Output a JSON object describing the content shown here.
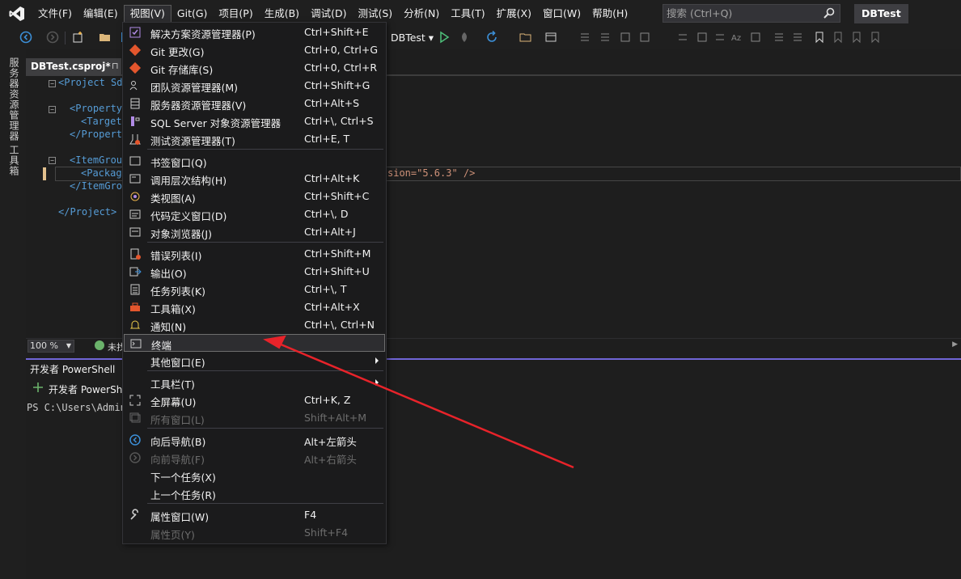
{
  "menubar": {
    "items": [
      "文件(F)",
      "编辑(E)",
      "视图(V)",
      "Git(G)",
      "项目(P)",
      "生成(B)",
      "调试(D)",
      "测试(S)",
      "分析(N)",
      "工具(T)",
      "扩展(X)",
      "窗口(W)",
      "帮助(H)"
    ],
    "search_placeholder": "搜索 (Ctrl+Q)",
    "solution_name": "DBTest"
  },
  "toolbar": {
    "config": "DBTest ▾"
  },
  "side_tabs": [
    "服务器资源管理器",
    "工具箱"
  ],
  "document": {
    "tab_label": "DBTest.csproj*",
    "tab_pin": "⊓",
    "lines": [
      "<Project Sd",
      "<Property",
      "<Target",
      "</Property",
      "<ItemGroup",
      "<Package",
      "</ItemGrou",
      "</Project>"
    ],
    "line6_tail": "sion=\"5.6.3\" />",
    "zoom": "100 %",
    "issues": "未找"
  },
  "panel": {
    "title": "开发者 PowerShell",
    "new_terminal": "开发者 PowerSh",
    "prompt": "PS C:\\Users\\Admin"
  },
  "view_menu": {
    "items": [
      {
        "label": "解决方案资源管理器(P)",
        "shortcut": "Ctrl+Shift+E",
        "icon": "solution-explorer-icon"
      },
      {
        "label": "Git 更改(G)",
        "shortcut": "Ctrl+0, Ctrl+G",
        "icon": "git-changes-icon"
      },
      {
        "label": "Git 存储库(S)",
        "shortcut": "Ctrl+0, Ctrl+R",
        "icon": "git-repository-icon"
      },
      {
        "label": "团队资源管理器(M)",
        "shortcut": "Ctrl+Shift+G",
        "icon": "team-explorer-icon"
      },
      {
        "label": "服务器资源管理器(V)",
        "shortcut": "Ctrl+Alt+S",
        "icon": "server-explorer-icon"
      },
      {
        "label": "SQL Server 对象资源管理器",
        "shortcut": "Ctrl+\\, Ctrl+S",
        "icon": "sql-server-icon"
      },
      {
        "label": "测试资源管理器(T)",
        "shortcut": "Ctrl+E, T",
        "icon": "test-explorer-icon"
      },
      {
        "label": "书签窗口(Q)",
        "shortcut": "",
        "icon": "bookmark-window-icon"
      },
      {
        "label": "调用层次结构(H)",
        "shortcut": "Ctrl+Alt+K",
        "icon": "call-hierarchy-icon"
      },
      {
        "label": "类视图(A)",
        "shortcut": "Ctrl+Shift+C",
        "icon": "class-view-icon"
      },
      {
        "label": "代码定义窗口(D)",
        "shortcut": "Ctrl+\\, D",
        "icon": "code-definition-icon"
      },
      {
        "label": "对象浏览器(J)",
        "shortcut": "Ctrl+Alt+J",
        "icon": "object-browser-icon"
      },
      {
        "label": "错误列表(I)",
        "shortcut": "Ctrl+Shift+M",
        "icon": "error-list-icon"
      },
      {
        "label": "输出(O)",
        "shortcut": "Ctrl+Shift+U",
        "icon": "output-icon"
      },
      {
        "label": "任务列表(K)",
        "shortcut": "Ctrl+\\, T",
        "icon": "task-list-icon"
      },
      {
        "label": "工具箱(X)",
        "shortcut": "Ctrl+Alt+X",
        "icon": "toolbox-icon"
      },
      {
        "label": "通知(N)",
        "shortcut": "Ctrl+\\, Ctrl+N",
        "icon": "bell-icon"
      },
      {
        "label": "终端",
        "shortcut": "",
        "icon": "terminal-icon"
      },
      {
        "label": "其他窗口(E)",
        "shortcut": "",
        "icon": ""
      },
      {
        "label": "工具栏(T)",
        "shortcut": "",
        "icon": ""
      },
      {
        "label": "全屏幕(U)",
        "shortcut": "Ctrl+K, Z",
        "icon": "full-screen-icon"
      },
      {
        "label": "所有窗口(L)",
        "shortcut": "Shift+Alt+M",
        "icon": "all-windows-icon"
      },
      {
        "label": "向后导航(B)",
        "shortcut": "Alt+左箭头",
        "icon": "navigate-back-icon"
      },
      {
        "label": "向前导航(F)",
        "shortcut": "Alt+右箭头",
        "icon": "navigate-forward-icon"
      },
      {
        "label": "下一个任务(X)",
        "shortcut": "",
        "icon": ""
      },
      {
        "label": "上一个任务(R)",
        "shortcut": "",
        "icon": ""
      },
      {
        "label": "属性窗口(W)",
        "shortcut": "F4",
        "icon": "wrench-icon"
      },
      {
        "label": "属性页(Y)",
        "shortcut": "Shift+F4",
        "icon": ""
      }
    ],
    "highlighted_index": 17
  },
  "colors": {
    "accent": "#7065d6",
    "annotation_arrow": "#e8232a"
  }
}
